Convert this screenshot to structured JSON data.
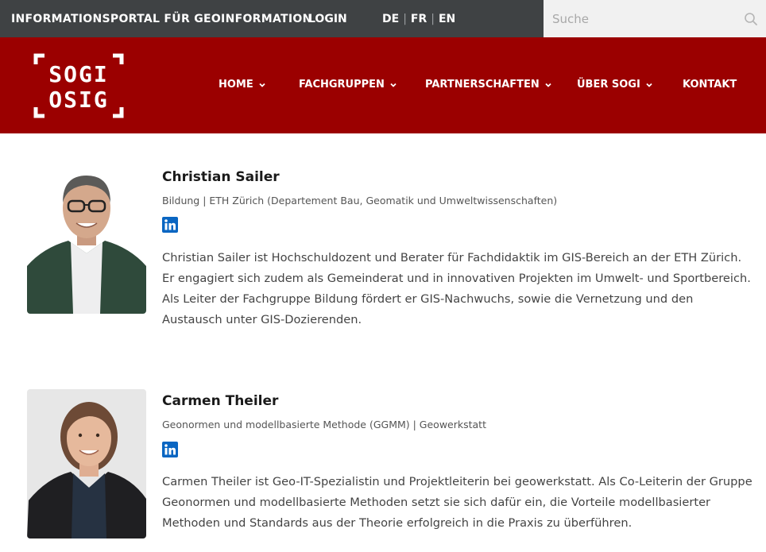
{
  "topbar": {
    "portal_title": "INFORMATIONSPORTAL FÜR GEOINFORMATION",
    "login": "LOGIN",
    "languages": [
      "DE",
      "FR",
      "EN"
    ],
    "search_placeholder": "Suche"
  },
  "logo": {
    "line1": "SOGI",
    "line2": "OSIG"
  },
  "nav": [
    {
      "label": "HOME",
      "dropdown": true
    },
    {
      "label": "FACHGRUPPEN",
      "dropdown": true
    },
    {
      "label": "PARTNERSCHAFTEN",
      "dropdown": true
    },
    {
      "label": "ÜBER SOGI",
      "dropdown": true
    },
    {
      "label": "KONTAKT",
      "dropdown": false
    }
  ],
  "people": [
    {
      "name": "Christian Sailer",
      "role": "Bildung | ETH Zürich (Departement Bau, Geomatik und Umweltwissenschaften)",
      "description": "Christian Sailer ist Hochschuldozent und Berater für Fachdidaktik im GIS-Bereich an der ETH Zürich. Er engagiert sich zudem als Gemeinderat und in innovativen Projekten im Umwelt- und Sportbereich. Als Leiter der Fachgruppe Bildung fördert er GIS-Nachwuchs, sowie die Vernetzung und den Austausch unter GIS-Dozierenden."
    },
    {
      "name": "Carmen Theiler",
      "role": "Geonormen und modellbasierte Methode (GGMM) | Geowerkstatt",
      "description": "Carmen Theiler ist Geo-IT-Spezialistin und Projektleiterin bei geowerkstatt. Als Co-Leiterin der Gruppe Geonormen und modellbasierte Methoden setzt sie sich dafür ein, die Vorteile modellbasierter Methoden und Standards aus der Theorie erfolgreich in die Praxis zu überführen."
    }
  ],
  "colors": {
    "topbar_bg": "#3f4244",
    "header_bg": "#9b0000",
    "linkedin": "#0a66c2"
  },
  "icons": {
    "search": "search-icon",
    "dropdown": "chevron-down-icon",
    "linkedin": "linkedin-icon"
  }
}
